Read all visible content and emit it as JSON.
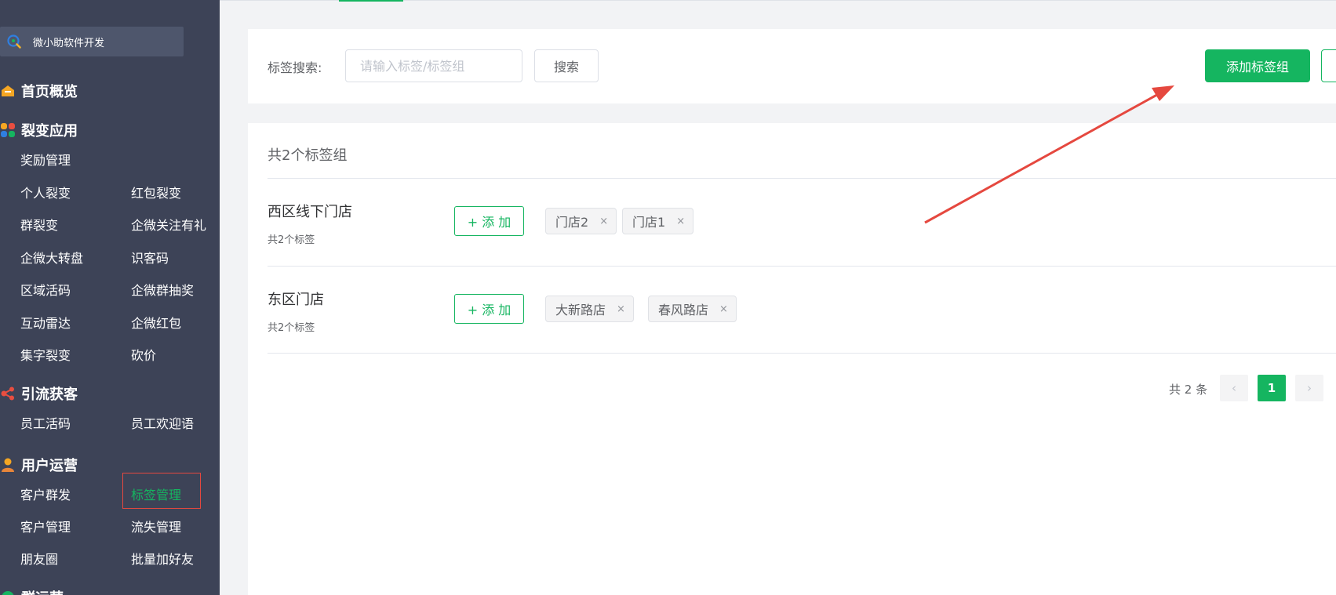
{
  "sidebar": {
    "brand": "微小助软件开发",
    "sections": [
      {
        "title": "首页概览",
        "icon": "home-icon"
      },
      {
        "title": "裂变应用",
        "icon": "apps-grid-icon"
      },
      {
        "title": "引流获客",
        "icon": "share-nodes-icon"
      },
      {
        "title": "用户运营",
        "icon": "user-icon"
      },
      {
        "title": "群运营",
        "icon": "group-icon"
      }
    ],
    "items": [
      "奖励管理",
      "个人裂变",
      "红包裂变",
      "群裂变",
      "企微关注有礼",
      "企微大转盘",
      "识客码",
      "区域活码",
      "企微群抽奖",
      "互动雷达",
      "企微红包",
      "集字裂变",
      "砍价",
      "员工活码",
      "员工欢迎语",
      "客户群发",
      "标签管理",
      "客户管理",
      "流失管理",
      "朋友圈",
      "批量加好友"
    ]
  },
  "search": {
    "label": "标签搜索:",
    "placeholder": "请输入标签/标签组",
    "button": "搜索",
    "add_group_button": "添加标签组"
  },
  "list": {
    "count_text": "共2个标签组",
    "groups": [
      {
        "name": "西区线下门店",
        "sub": "共2个标签",
        "add_label": "+ 添 加",
        "tags": [
          "门店2",
          "门店1"
        ]
      },
      {
        "name": "东区门店",
        "sub": "共2个标签",
        "add_label": "+ 添 加",
        "tags": [
          "大新路店",
          "春风路店"
        ]
      }
    ],
    "close_glyph": "×"
  },
  "pagination": {
    "total_text": "共 2 条",
    "current_page": "1",
    "prev_glyph": "‹",
    "next_glyph": "›"
  },
  "colors": {
    "sidebar_bg": "#3d4357",
    "accent": "#15b560",
    "annotation_red": "#e5483f"
  }
}
